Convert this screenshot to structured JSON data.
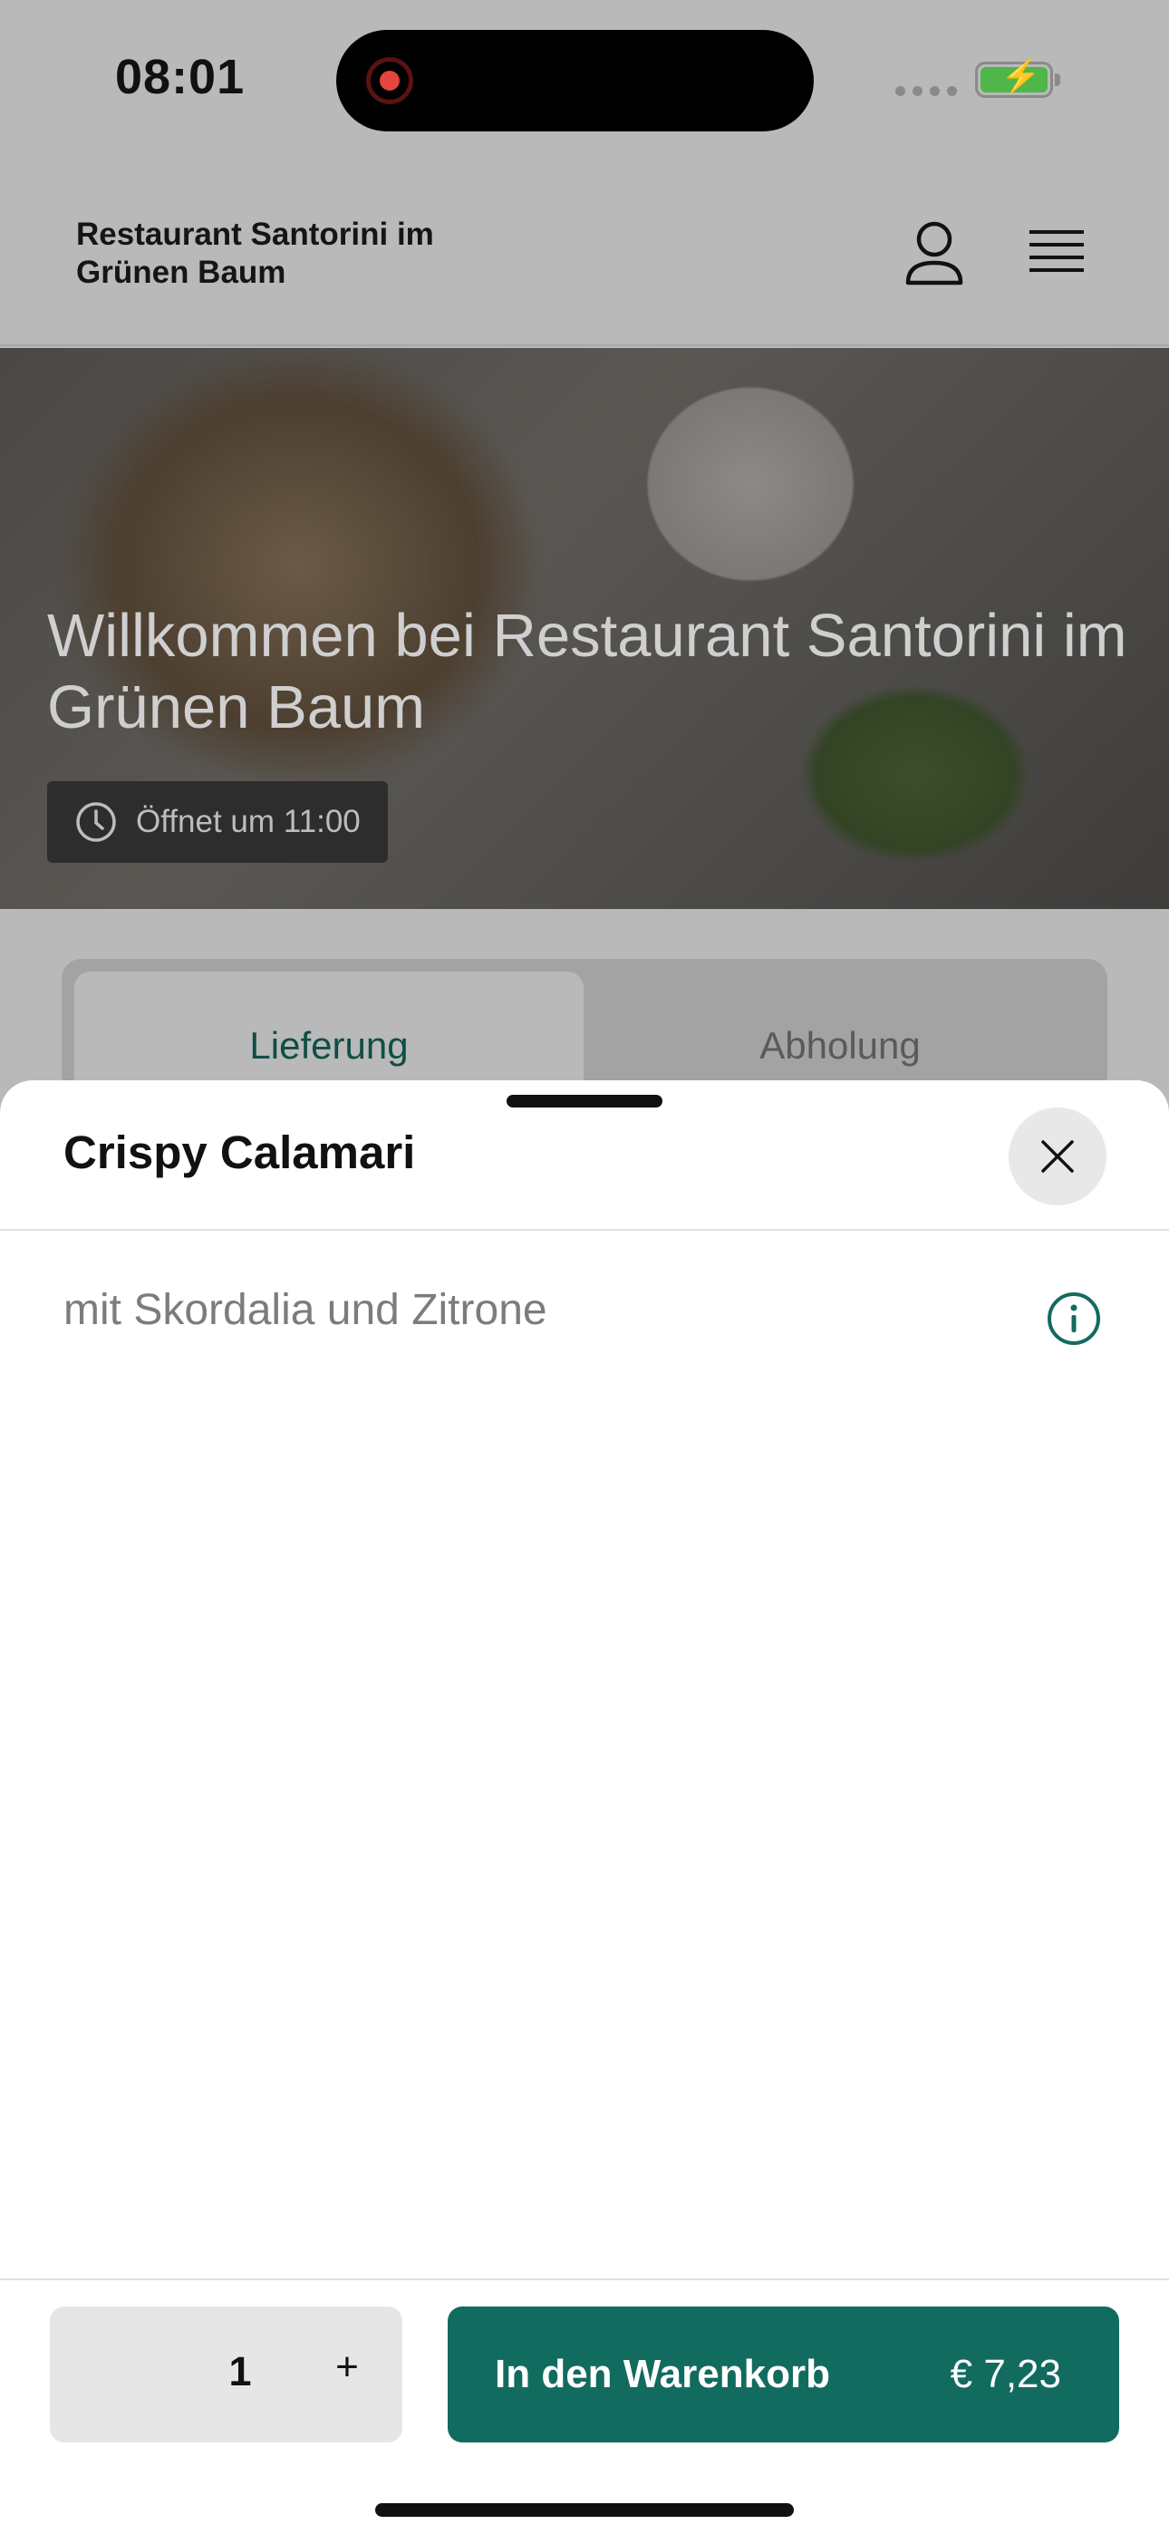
{
  "status_bar": {
    "time": "08:01"
  },
  "header": {
    "restaurant_name": "Restaurant Santorini im Grünen Baum"
  },
  "hero": {
    "title": "Willkommen bei Restaurant Santorini im Grünen Baum",
    "opening_status": "Öffnet um 11:00"
  },
  "tabs": [
    {
      "label": "Lieferung",
      "active": true
    },
    {
      "label": "Abholung",
      "active": false
    }
  ],
  "sheet": {
    "title": "Crispy Calamari",
    "description": "mit Skordalia und Zitrone",
    "quantity": "1",
    "plus_label": "+",
    "add_to_cart_label": "In den Warenkorb",
    "price": "€ 7,23"
  },
  "colors": {
    "brand": "#126b5f",
    "brand_text": "#0f4e45",
    "battery": "#4fb64a",
    "record": "#e5453c"
  },
  "icons": [
    "record-icon",
    "battery-icon",
    "user-icon",
    "menu-icon",
    "clock-icon",
    "close-icon",
    "info-icon"
  ]
}
